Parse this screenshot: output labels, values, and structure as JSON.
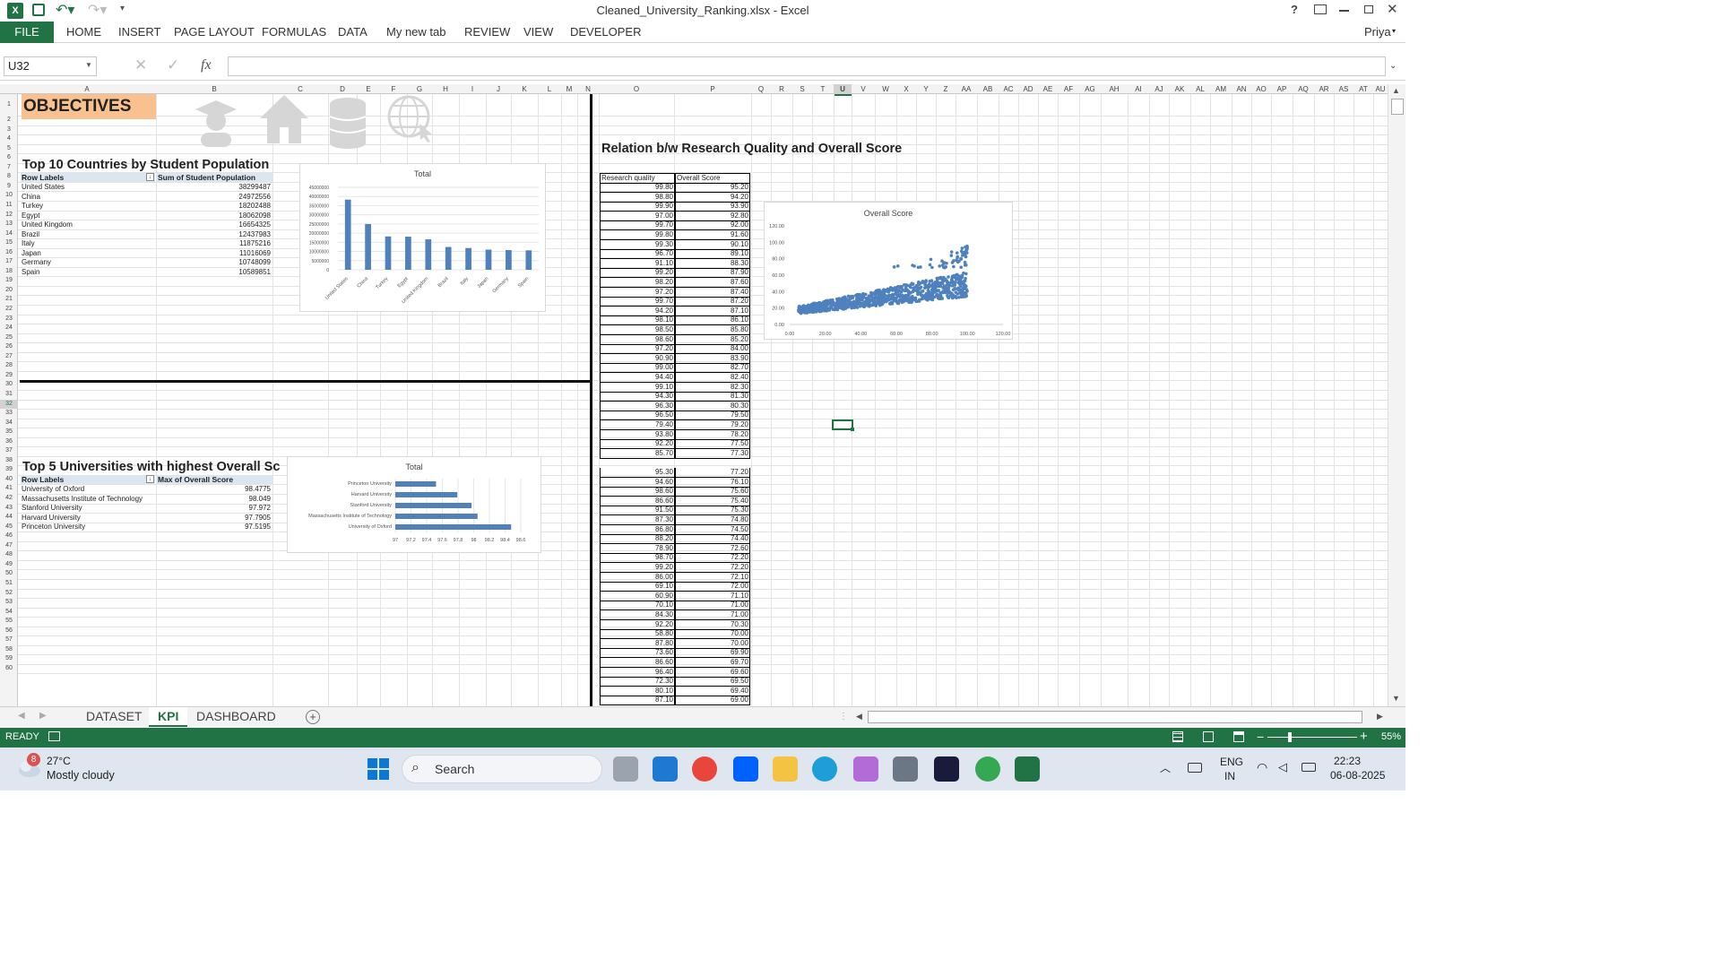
{
  "window": {
    "title": "Cleaned_University_Ranking.xlsx - Excel",
    "user": "Priya",
    "help": "?"
  },
  "ribbon": {
    "file": "FILE",
    "tabs": [
      "HOME",
      "INSERT",
      "PAGE LAYOUT",
      "FORMULAS",
      "DATA",
      "My new tab",
      "REVIEW",
      "VIEW",
      "DEVELOPER"
    ]
  },
  "formula": {
    "namebox": "U32",
    "fx": "fx",
    "value": ""
  },
  "columns": [
    "A",
    "B",
    "C",
    "D",
    "E",
    "F",
    "G",
    "H",
    "I",
    "J",
    "K",
    "L",
    "M",
    "N",
    "O",
    "P",
    "Q",
    "R",
    "S",
    "T",
    "U",
    "V",
    "W",
    "X",
    "Y",
    "Z",
    "AA",
    "AB",
    "AC",
    "AD",
    "AE",
    "AF",
    "AG",
    "AH",
    "AI",
    "AJ",
    "AK",
    "AL",
    "AM",
    "AN",
    "AO",
    "AP",
    "AQ",
    "AR",
    "AS",
    "AT",
    "AU"
  ],
  "sheet": {
    "objectives": "OBJECTIVES",
    "countries_title": "Top 10 Countries by Student Population",
    "pivot1_headers": [
      "Row Labels",
      "Sum of Student Population"
    ],
    "pivot1_rows": [
      [
        "United States",
        "38299487"
      ],
      [
        "China",
        "24972556"
      ],
      [
        "Turkey",
        "18202488"
      ],
      [
        "Egypt",
        "18062098"
      ],
      [
        "United Kingdom",
        "16654325"
      ],
      [
        "Brazil",
        "12437983"
      ],
      [
        "Italy",
        "11875216"
      ],
      [
        "Japan",
        "11016069"
      ],
      [
        "Germany",
        "10748099"
      ],
      [
        "Spain",
        "10589851"
      ]
    ],
    "univ_title": "Top 5 Universities with highest Overall Sc",
    "pivot2_headers": [
      "Row Labels",
      "Max of Overall Score"
    ],
    "pivot2_rows": [
      [
        "University of Oxford",
        "98.4775"
      ],
      [
        "Massachusetts Institute of Technology",
        "98.049"
      ],
      [
        "Stanford University",
        "97.972"
      ],
      [
        "Harvard University",
        "97.7905"
      ],
      [
        "Princeton University",
        "97.5195"
      ]
    ],
    "relation_title": "Relation b/w Research Quality and Overall Score",
    "rq_headers": [
      "Research quality",
      "Overall Score"
    ],
    "rq_rows": [
      [
        "99.80",
        "95.20"
      ],
      [
        "98.80",
        "94.20"
      ],
      [
        "99.90",
        "93.90"
      ],
      [
        "97.00",
        "92.80"
      ],
      [
        "99.70",
        "92.00"
      ],
      [
        "99.80",
        "91.60"
      ],
      [
        "99.30",
        "90.10"
      ],
      [
        "96.70",
        "89.10"
      ],
      [
        "91.10",
        "88.30"
      ],
      [
        "99.20",
        "87.90"
      ],
      [
        "98.20",
        "87.60"
      ],
      [
        "97.20",
        "87.40"
      ],
      [
        "99.70",
        "87.20"
      ],
      [
        "94.20",
        "87.10"
      ],
      [
        "98.10",
        "86.10"
      ],
      [
        "98.50",
        "85.80"
      ],
      [
        "98.60",
        "85.20"
      ],
      [
        "97.20",
        "84.00"
      ],
      [
        "90.90",
        "83.90"
      ],
      [
        "99.00",
        "82.70"
      ],
      [
        "94.40",
        "82.40"
      ],
      [
        "99.10",
        "82.30"
      ],
      [
        "94.30",
        "81.30"
      ],
      [
        "96.30",
        "80.30"
      ],
      [
        "96.50",
        "79.50"
      ],
      [
        "79.40",
        "79.20"
      ],
      [
        "93.80",
        "78.20"
      ],
      [
        "92.20",
        "77.50"
      ],
      [
        "85.70",
        "77.30"
      ],
      [
        "",
        ""
      ],
      [
        "95.30",
        "77.20"
      ],
      [
        "94.60",
        "76.10"
      ],
      [
        "98.60",
        "75.60"
      ],
      [
        "86.60",
        "75.40"
      ],
      [
        "91.50",
        "75.30"
      ],
      [
        "87.30",
        "74.80"
      ],
      [
        "86.80",
        "74.50"
      ],
      [
        "88.20",
        "74.40"
      ],
      [
        "78.90",
        "72.60"
      ],
      [
        "98.70",
        "72.20"
      ],
      [
        "99.20",
        "72.20"
      ],
      [
        "86.00",
        "72.10"
      ],
      [
        "69.10",
        "72.00"
      ],
      [
        "60.90",
        "71.10"
      ],
      [
        "70.10",
        "71.00"
      ],
      [
        "84.30",
        "71.00"
      ],
      [
        "92.20",
        "70.30"
      ],
      [
        "58.80",
        "70.00"
      ],
      [
        "87.80",
        "70.00"
      ],
      [
        "73.60",
        "69.90"
      ],
      [
        "86.60",
        "69.70"
      ],
      [
        "96.40",
        "69.60"
      ],
      [
        "72.30",
        "69.50"
      ],
      [
        "80.10",
        "69.40"
      ],
      [
        "87.10",
        "69.00"
      ]
    ]
  },
  "chart_data": [
    {
      "type": "bar",
      "title": "Total",
      "categories": [
        "United States",
        "China",
        "Turkey",
        "Egypt",
        "United Kingdom",
        "Brazil",
        "Italy",
        "Japan",
        "Germany",
        "Spain"
      ],
      "values": [
        38299487,
        24972556,
        18202488,
        18062098,
        16654325,
        12437983,
        11875216,
        11016069,
        10748099,
        10589851
      ],
      "ylim": [
        0,
        45000000
      ],
      "yticks": [
        "45000000",
        "40000000",
        "35000000",
        "30000000",
        "25000000",
        "20000000",
        "15000000",
        "10000000",
        "5000000",
        "0"
      ],
      "color": "#4f81bd"
    },
    {
      "type": "bar",
      "orientation": "horizontal",
      "title": "Total",
      "categories": [
        "Princeton University",
        "Harvard University",
        "Stanford University",
        "Massachusetts Institute of Technology",
        "University of Oxford"
      ],
      "values": [
        97.5195,
        97.7905,
        97.972,
        98.049,
        98.4775
      ],
      "xlim": [
        97,
        98.6
      ],
      "xticks": [
        "97",
        "97.2",
        "97.4",
        "97.6",
        "97.8",
        "98",
        "98.2",
        "98.4",
        "98.6"
      ],
      "color": "#4f81bd"
    },
    {
      "type": "scatter",
      "title": "Overall Score",
      "xlim": [
        0,
        120
      ],
      "ylim": [
        0,
        120
      ],
      "xticks": [
        "0.00",
        "20.00",
        "40.00",
        "60.00",
        "80.00",
        "100.00",
        "120.00"
      ],
      "yticks": [
        "120.00",
        "100.00",
        "80.00",
        "60.00",
        "40.00",
        "20.00",
        "0.00"
      ],
      "color": "#4f81bd"
    }
  ],
  "sheettabs": [
    "DATASET",
    "KPI",
    "DASHBOARD"
  ],
  "status": {
    "ready": "READY",
    "zoom": "55%"
  },
  "taskbar": {
    "temp": "27°C",
    "weather": "Mostly cloudy",
    "badge": "8",
    "search": "Search",
    "lang1": "ENG",
    "lang2": "IN",
    "time": "22:23",
    "date": "06-08-2025"
  }
}
